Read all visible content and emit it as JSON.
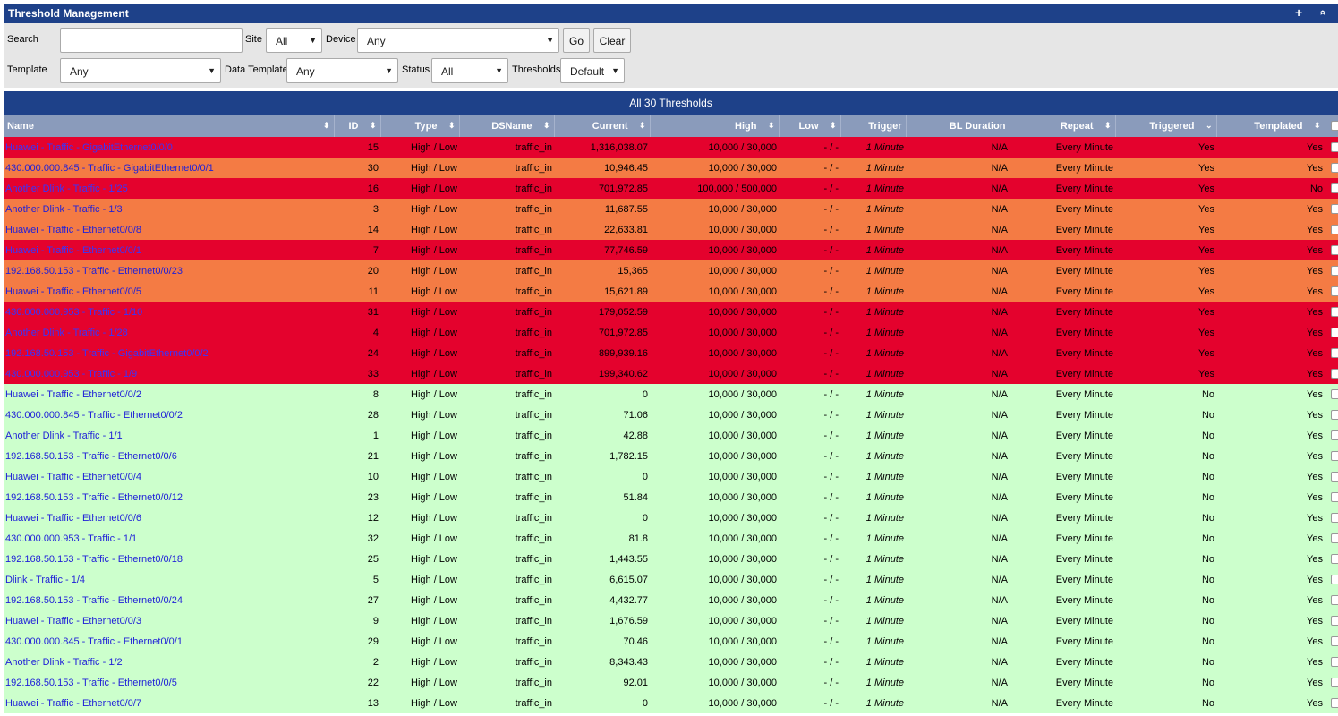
{
  "panel": {
    "title": "Threshold Management",
    "add_icon": "+",
    "collapse_icon": "»"
  },
  "filters": {
    "search_label": "Search",
    "search_value": "",
    "site_label": "Site",
    "site_value": "All",
    "device_label": "Device",
    "device_value": "Any",
    "go_label": "Go",
    "clear_label": "Clear",
    "template_label": "Template",
    "template_value": "Any",
    "data_template_label": "Data Template",
    "data_template_value": "Any",
    "status_label": "Status",
    "status_value": "All",
    "thresholds_label": "Thresholds",
    "thresholds_value": "Default"
  },
  "summary": "All 30 Thresholds",
  "columns": [
    "Name",
    "ID",
    "Type",
    "DSName",
    "Current",
    "High",
    "Low",
    "Trigger",
    "BL Duration",
    "Repeat",
    "Triggered",
    "Templated"
  ],
  "colors": {
    "header": "#1e4189",
    "column_header": "#8a9bbb",
    "alert": "#e4022d",
    "warning": "#f47b44",
    "normal": "#ccffcc"
  },
  "rows": [
    {
      "sev": "red",
      "name": "Huawei - Traffic - GigabitEthernet0/0/0",
      "id": "15",
      "type": "High / Low",
      "ds": "traffic_in",
      "current": "1,316,038.07",
      "high": "10,000 / 30,000",
      "low": "- / -",
      "trigger": "1 Minute",
      "bl": "N/A",
      "repeat": "Every Minute",
      "triggered": "Yes",
      "templated": "Yes"
    },
    {
      "sev": "orange",
      "name": "430.000.000.845 - Traffic - GigabitEthernet0/0/1",
      "id": "30",
      "type": "High / Low",
      "ds": "traffic_in",
      "current": "10,946.45",
      "high": "10,000 / 30,000",
      "low": "- / -",
      "trigger": "1 Minute",
      "bl": "N/A",
      "repeat": "Every Minute",
      "triggered": "Yes",
      "templated": "Yes"
    },
    {
      "sev": "red",
      "name": "Another Dlink - Traffic - 1/25",
      "id": "16",
      "type": "High / Low",
      "ds": "traffic_in",
      "current": "701,972.85",
      "high": "100,000 / 500,000",
      "low": "- / -",
      "trigger": "1 Minute",
      "bl": "N/A",
      "repeat": "Every Minute",
      "triggered": "Yes",
      "templated": "No"
    },
    {
      "sev": "orange",
      "name": "Another Dlink - Traffic - 1/3",
      "id": "3",
      "type": "High / Low",
      "ds": "traffic_in",
      "current": "11,687.55",
      "high": "10,000 / 30,000",
      "low": "- / -",
      "trigger": "1 Minute",
      "bl": "N/A",
      "repeat": "Every Minute",
      "triggered": "Yes",
      "templated": "Yes"
    },
    {
      "sev": "orange",
      "name": "Huawei - Traffic - Ethernet0/0/8",
      "id": "14",
      "type": "High / Low",
      "ds": "traffic_in",
      "current": "22,633.81",
      "high": "10,000 / 30,000",
      "low": "- / -",
      "trigger": "1 Minute",
      "bl": "N/A",
      "repeat": "Every Minute",
      "triggered": "Yes",
      "templated": "Yes"
    },
    {
      "sev": "red",
      "name": "Huawei - Traffic - Ethernet0/0/1",
      "id": "7",
      "type": "High / Low",
      "ds": "traffic_in",
      "current": "77,746.59",
      "high": "10,000 / 30,000",
      "low": "- / -",
      "trigger": "1 Minute",
      "bl": "N/A",
      "repeat": "Every Minute",
      "triggered": "Yes",
      "templated": "Yes"
    },
    {
      "sev": "orange",
      "name": "192.168.50.153 - Traffic - Ethernet0/0/23",
      "id": "20",
      "type": "High / Low",
      "ds": "traffic_in",
      "current": "15,365",
      "high": "10,000 / 30,000",
      "low": "- / -",
      "trigger": "1 Minute",
      "bl": "N/A",
      "repeat": "Every Minute",
      "triggered": "Yes",
      "templated": "Yes"
    },
    {
      "sev": "orange",
      "name": "Huawei - Traffic - Ethernet0/0/5",
      "id": "11",
      "type": "High / Low",
      "ds": "traffic_in",
      "current": "15,621.89",
      "high": "10,000 / 30,000",
      "low": "- / -",
      "trigger": "1 Minute",
      "bl": "N/A",
      "repeat": "Every Minute",
      "triggered": "Yes",
      "templated": "Yes"
    },
    {
      "sev": "red",
      "name": "430.000.000.953 - Traffic - 1/10",
      "id": "31",
      "type": "High / Low",
      "ds": "traffic_in",
      "current": "179,052.59",
      "high": "10,000 / 30,000",
      "low": "- / -",
      "trigger": "1 Minute",
      "bl": "N/A",
      "repeat": "Every Minute",
      "triggered": "Yes",
      "templated": "Yes"
    },
    {
      "sev": "red",
      "name": "Another Dlink - Traffic - 1/28",
      "id": "4",
      "type": "High / Low",
      "ds": "traffic_in",
      "current": "701,972.85",
      "high": "10,000 / 30,000",
      "low": "- / -",
      "trigger": "1 Minute",
      "bl": "N/A",
      "repeat": "Every Minute",
      "triggered": "Yes",
      "templated": "Yes"
    },
    {
      "sev": "red",
      "name": "192.168.50.153 - Traffic - GigabitEthernet0/0/2",
      "id": "24",
      "type": "High / Low",
      "ds": "traffic_in",
      "current": "899,939.16",
      "high": "10,000 / 30,000",
      "low": "- / -",
      "trigger": "1 Minute",
      "bl": "N/A",
      "repeat": "Every Minute",
      "triggered": "Yes",
      "templated": "Yes"
    },
    {
      "sev": "red",
      "name": "430.000.000.953 - Traffic - 1/9",
      "id": "33",
      "type": "High / Low",
      "ds": "traffic_in",
      "current": "199,340.62",
      "high": "10,000 / 30,000",
      "low": "- / -",
      "trigger": "1 Minute",
      "bl": "N/A",
      "repeat": "Every Minute",
      "triggered": "Yes",
      "templated": "Yes"
    },
    {
      "sev": "ok",
      "name": "Huawei - Traffic - Ethernet0/0/2",
      "id": "8",
      "type": "High / Low",
      "ds": "traffic_in",
      "current": "0",
      "high": "10,000 / 30,000",
      "low": "- / -",
      "trigger": "1 Minute",
      "bl": "N/A",
      "repeat": "Every Minute",
      "triggered": "No",
      "templated": "Yes"
    },
    {
      "sev": "ok",
      "name": "430.000.000.845 - Traffic - Ethernet0/0/2",
      "id": "28",
      "type": "High / Low",
      "ds": "traffic_in",
      "current": "71.06",
      "high": "10,000 / 30,000",
      "low": "- / -",
      "trigger": "1 Minute",
      "bl": "N/A",
      "repeat": "Every Minute",
      "triggered": "No",
      "templated": "Yes"
    },
    {
      "sev": "ok",
      "name": "Another Dlink - Traffic - 1/1",
      "id": "1",
      "type": "High / Low",
      "ds": "traffic_in",
      "current": "42.88",
      "high": "10,000 / 30,000",
      "low": "- / -",
      "trigger": "1 Minute",
      "bl": "N/A",
      "repeat": "Every Minute",
      "triggered": "No",
      "templated": "Yes"
    },
    {
      "sev": "ok",
      "name": "192.168.50.153 - Traffic - Ethernet0/0/6",
      "id": "21",
      "type": "High / Low",
      "ds": "traffic_in",
      "current": "1,782.15",
      "high": "10,000 / 30,000",
      "low": "- / -",
      "trigger": "1 Minute",
      "bl": "N/A",
      "repeat": "Every Minute",
      "triggered": "No",
      "templated": "Yes"
    },
    {
      "sev": "ok",
      "name": "Huawei - Traffic - Ethernet0/0/4",
      "id": "10",
      "type": "High / Low",
      "ds": "traffic_in",
      "current": "0",
      "high": "10,000 / 30,000",
      "low": "- / -",
      "trigger": "1 Minute",
      "bl": "N/A",
      "repeat": "Every Minute",
      "triggered": "No",
      "templated": "Yes"
    },
    {
      "sev": "ok",
      "name": "192.168.50.153 - Traffic - Ethernet0/0/12",
      "id": "23",
      "type": "High / Low",
      "ds": "traffic_in",
      "current": "51.84",
      "high": "10,000 / 30,000",
      "low": "- / -",
      "trigger": "1 Minute",
      "bl": "N/A",
      "repeat": "Every Minute",
      "triggered": "No",
      "templated": "Yes"
    },
    {
      "sev": "ok",
      "name": "Huawei - Traffic - Ethernet0/0/6",
      "id": "12",
      "type": "High / Low",
      "ds": "traffic_in",
      "current": "0",
      "high": "10,000 / 30,000",
      "low": "- / -",
      "trigger": "1 Minute",
      "bl": "N/A",
      "repeat": "Every Minute",
      "triggered": "No",
      "templated": "Yes"
    },
    {
      "sev": "ok",
      "name": "430.000.000.953 - Traffic - 1/1",
      "id": "32",
      "type": "High / Low",
      "ds": "traffic_in",
      "current": "81.8",
      "high": "10,000 / 30,000",
      "low": "- / -",
      "trigger": "1 Minute",
      "bl": "N/A",
      "repeat": "Every Minute",
      "triggered": "No",
      "templated": "Yes"
    },
    {
      "sev": "ok",
      "name": "192.168.50.153 - Traffic - Ethernet0/0/18",
      "id": "25",
      "type": "High / Low",
      "ds": "traffic_in",
      "current": "1,443.55",
      "high": "10,000 / 30,000",
      "low": "- / -",
      "trigger": "1 Minute",
      "bl": "N/A",
      "repeat": "Every Minute",
      "triggered": "No",
      "templated": "Yes"
    },
    {
      "sev": "ok",
      "name": "Dlink - Traffic - 1/4",
      "id": "5",
      "type": "High / Low",
      "ds": "traffic_in",
      "current": "6,615.07",
      "high": "10,000 / 30,000",
      "low": "- / -",
      "trigger": "1 Minute",
      "bl": "N/A",
      "repeat": "Every Minute",
      "triggered": "No",
      "templated": "Yes"
    },
    {
      "sev": "ok",
      "name": "192.168.50.153 - Traffic - Ethernet0/0/24",
      "id": "27",
      "type": "High / Low",
      "ds": "traffic_in",
      "current": "4,432.77",
      "high": "10,000 / 30,000",
      "low": "- / -",
      "trigger": "1 Minute",
      "bl": "N/A",
      "repeat": "Every Minute",
      "triggered": "No",
      "templated": "Yes"
    },
    {
      "sev": "ok",
      "name": "Huawei - Traffic - Ethernet0/0/3",
      "id": "9",
      "type": "High / Low",
      "ds": "traffic_in",
      "current": "1,676.59",
      "high": "10,000 / 30,000",
      "low": "- / -",
      "trigger": "1 Minute",
      "bl": "N/A",
      "repeat": "Every Minute",
      "triggered": "No",
      "templated": "Yes"
    },
    {
      "sev": "ok",
      "name": "430.000.000.845 - Traffic - Ethernet0/0/1",
      "id": "29",
      "type": "High / Low",
      "ds": "traffic_in",
      "current": "70.46",
      "high": "10,000 / 30,000",
      "low": "- / -",
      "trigger": "1 Minute",
      "bl": "N/A",
      "repeat": "Every Minute",
      "triggered": "No",
      "templated": "Yes"
    },
    {
      "sev": "ok",
      "name": "Another Dlink - Traffic - 1/2",
      "id": "2",
      "type": "High / Low",
      "ds": "traffic_in",
      "current": "8,343.43",
      "high": "10,000 / 30,000",
      "low": "- / -",
      "trigger": "1 Minute",
      "bl": "N/A",
      "repeat": "Every Minute",
      "triggered": "No",
      "templated": "Yes"
    },
    {
      "sev": "ok",
      "name": "192.168.50.153 - Traffic - Ethernet0/0/5",
      "id": "22",
      "type": "High / Low",
      "ds": "traffic_in",
      "current": "92.01",
      "high": "10,000 / 30,000",
      "low": "- / -",
      "trigger": "1 Minute",
      "bl": "N/A",
      "repeat": "Every Minute",
      "triggered": "No",
      "templated": "Yes"
    },
    {
      "sev": "ok",
      "name": "Huawei - Traffic - Ethernet0/0/7",
      "id": "13",
      "type": "High / Low",
      "ds": "traffic_in",
      "current": "0",
      "high": "10,000 / 30,000",
      "low": "- / -",
      "trigger": "1 Minute",
      "bl": "N/A",
      "repeat": "Every Minute",
      "triggered": "No",
      "templated": "Yes"
    }
  ]
}
